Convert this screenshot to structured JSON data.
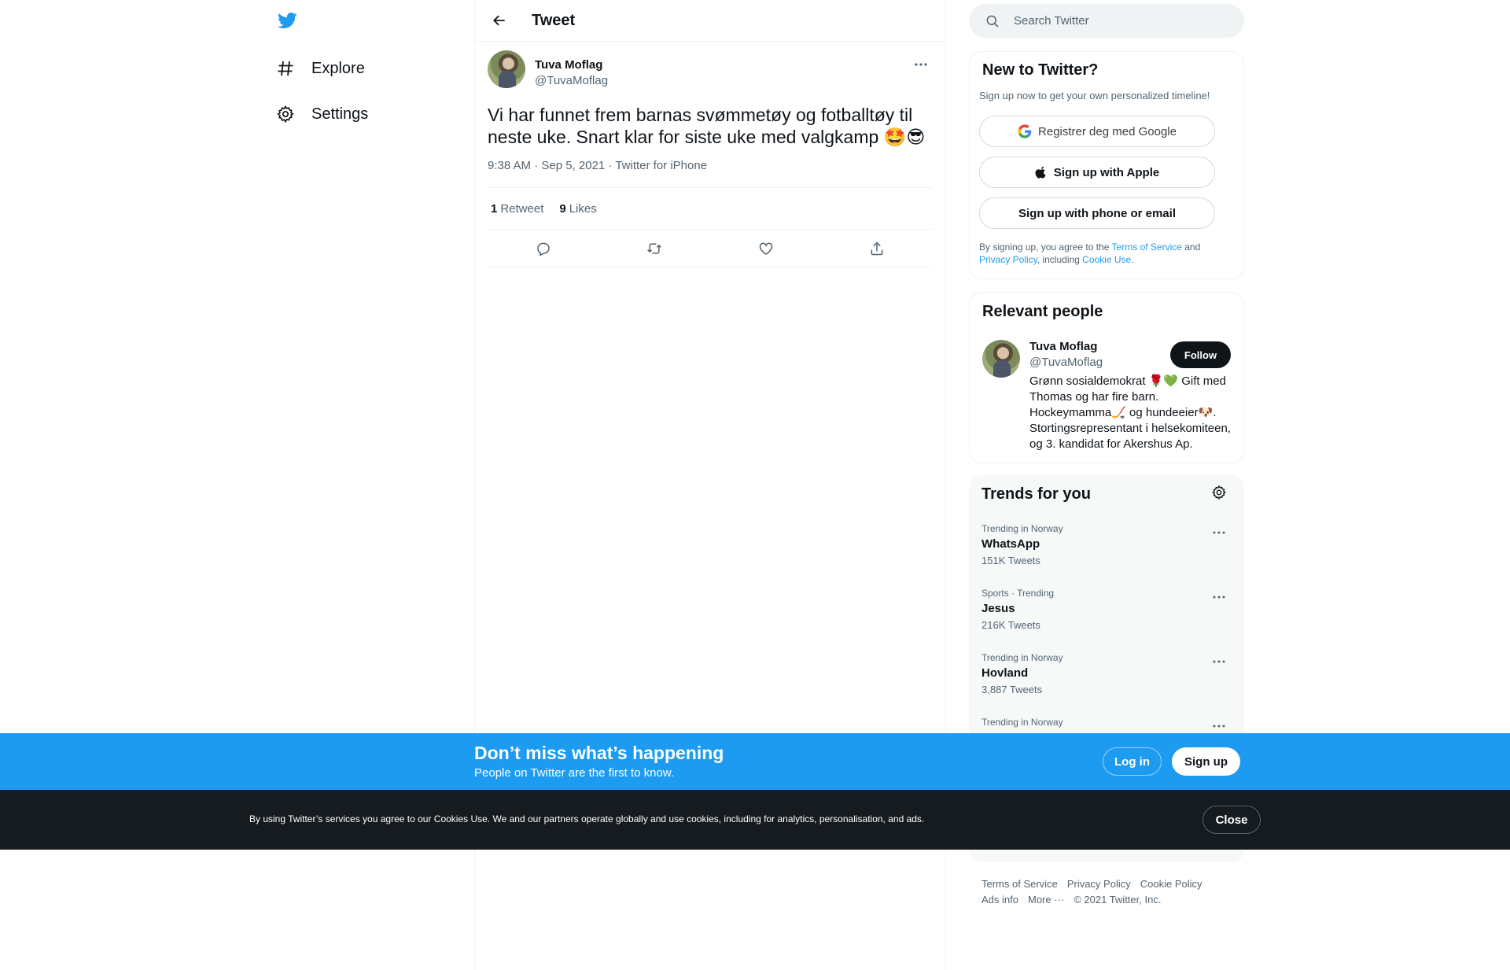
{
  "nav": {
    "logo_icon": "twitter-bird-icon",
    "items": [
      {
        "label": "Explore",
        "icon": "hashtag-icon"
      },
      {
        "label": "Settings",
        "icon": "gear-icon"
      }
    ]
  },
  "header": {
    "title": "Tweet",
    "back_icon": "arrow-left-icon"
  },
  "tweet": {
    "author_name": "Tuva Moflag",
    "author_handle": "@TuvaMoflag",
    "text": "Vi har funnet frem barnas svømmetøy og fotballtøy til neste uke. Snart klar for siste uke med valgkamp 🤩😎",
    "meta": "9:38 AM · Sep 5, 2021 · Twitter for iPhone",
    "retweets_count": "1",
    "retweets_label": "Retweet",
    "likes_count": "9",
    "likes_label": "Likes"
  },
  "search": {
    "placeholder": "Search Twitter"
  },
  "new_to_twitter": {
    "title": "New to Twitter?",
    "subtitle": "Sign up now to get your own personalized timeline!",
    "google_label": "Registrer deg med Google",
    "apple_label": "Sign up with Apple",
    "phone_label": "Sign up with phone or email",
    "legal_prefix": "By signing up, you agree to the ",
    "terms_link": "Terms of Service",
    "legal_and": " and ",
    "privacy_link": "Privacy Policy",
    "legal_including": ", including ",
    "cookie_link": "Cookie Use."
  },
  "relevant_people": {
    "title": "Relevant people",
    "name": "Tuva Moflag",
    "handle": "@TuvaMoflag",
    "follow_label": "Follow",
    "bio": "Grønn sosialdemokrat 🌹💚 Gift med Thomas og har fire barn. Hockeymamma🏒 og hundeeier🐶. Stortingsrepresentant i helsekomiteen, og 3. kandidat for Akershus Ap."
  },
  "trends": {
    "title": "Trends for you",
    "items": [
      {
        "context": "Trending in Norway",
        "name": "WhatsApp",
        "count": "151K Tweets"
      },
      {
        "context": "Sports · Trending",
        "name": "Jesus",
        "count": "216K Tweets"
      },
      {
        "context": "Trending in Norway",
        "name": "Hovland",
        "count": "3,887 Tweets"
      },
      {
        "context": "Trending in Norway",
        "name": "",
        "count": ""
      }
    ]
  },
  "footer": {
    "links": [
      "Terms of Service",
      "Privacy Policy",
      "Cookie Policy",
      "Ads info",
      "More ···",
      "© 2021 Twitter, Inc."
    ]
  },
  "signup_banner": {
    "title": "Don’t miss what’s happening",
    "subtitle": "People on Twitter are the first to know.",
    "login_label": "Log in",
    "signup_label": "Sign up"
  },
  "cookie_banner": {
    "text": "By using Twitter’s services you agree to our Cookies Use. We and our partners operate globally and use cookies, including for analytics, personalisation, and ads.",
    "close_label": "Close"
  },
  "colors": {
    "brand_blue": "#1d9bf0",
    "text_primary": "#0f1419",
    "text_secondary": "#536471",
    "cookie_bg": "#161b20"
  }
}
